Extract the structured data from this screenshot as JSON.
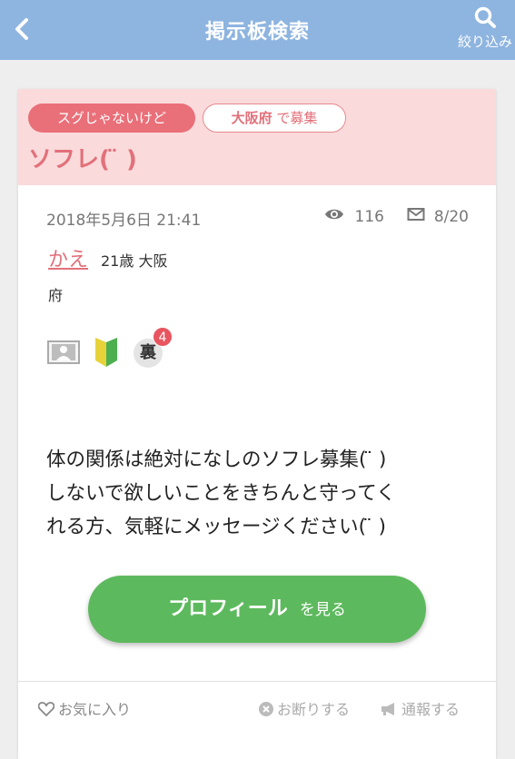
{
  "header": {
    "title": "掲示板検索",
    "filter_label": "絞り込み"
  },
  "post": {
    "badge_now": "スグじゃないけど",
    "area_name": "大阪府",
    "area_suffix": "で募集",
    "title": "ソフレ( ̈ )",
    "date": "2018年5月6日 21:41",
    "views": "116",
    "messages": "8/20",
    "user_name": "かえ",
    "user_info_line1": "21歳 大阪",
    "user_info_line2": "府",
    "ura_label": "裏",
    "ura_count": "4",
    "body": [
      "体の関係は絶対になしのソフレ募集( ̈ )",
      "しないで欲しいことをきちんと守ってく",
      "れる方、気軽にメッセージください( ̈ )"
    ],
    "profile_button_main": "プロフィール",
    "profile_button_sub": "を見る"
  },
  "footer": {
    "favorite": "お気に入り",
    "decline": "お断りする",
    "report": "通報する"
  },
  "colors": {
    "header_bg": "#8eb4e0",
    "accent_pink": "#e2707a",
    "card_head_bg": "#fadadb",
    "button_green": "#5db95d"
  }
}
